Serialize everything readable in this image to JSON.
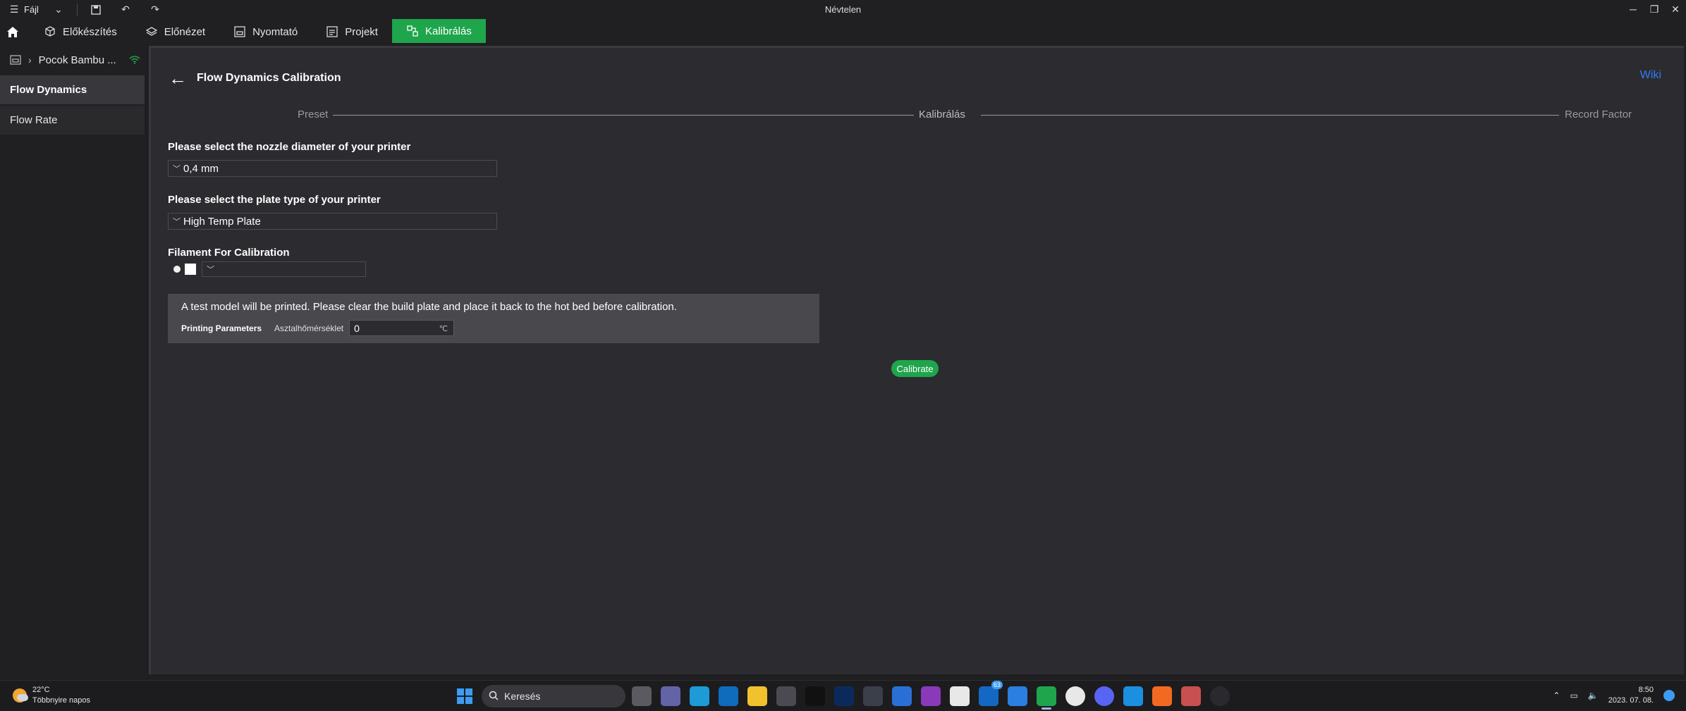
{
  "window": {
    "title": "Névtelen",
    "menu_label": "Fájl"
  },
  "tabs": [
    {
      "label": "Előkészítés",
      "icon": "cube-icon"
    },
    {
      "label": "Előnézet",
      "icon": "layers-icon"
    },
    {
      "label": "Nyomtató",
      "icon": "printer-icon"
    },
    {
      "label": "Projekt",
      "icon": "project-icon"
    },
    {
      "label": "Kalibrálás",
      "icon": "calibration-icon",
      "active": true
    }
  ],
  "sidebar": {
    "printer_name": "Pocok Bambu ...",
    "items": [
      {
        "label": "Flow Dynamics",
        "active": true
      },
      {
        "label": "Flow Rate",
        "active": false
      }
    ]
  },
  "main": {
    "title": "Flow Dynamics Calibration",
    "wiki_link": "Wiki",
    "steps": [
      "Preset",
      "Kalibrálás",
      "Record Factor"
    ],
    "nozzle": {
      "label": "Please select the nozzle diameter of your printer",
      "value": "0,4 mm"
    },
    "plate": {
      "label": "Please select the plate type of your printer",
      "value": "High Temp Plate"
    },
    "filament": {
      "label": "Filament For Calibration",
      "value": ""
    },
    "info": {
      "text": "A test model will be printed. Please clear the build plate and place it back to the hot bed before calibration.",
      "params_title": "Printing Parameters",
      "bed_temp_label": "Asztalhőmérséklet",
      "bed_temp_value": "0",
      "bed_temp_unit": "℃"
    },
    "calibrate_button": "Calibrate"
  },
  "taskbar": {
    "weather_temp": "22°C",
    "weather_desc": "Többnyire napos",
    "search_placeholder": "Keresés",
    "mail_badge": "63",
    "time": "8:50",
    "date": "2023. 07. 08."
  },
  "colors": {
    "accent": "#1fa54c",
    "link": "#2f7df6",
    "panel": "#2c2c30",
    "info_box": "#48484d"
  }
}
